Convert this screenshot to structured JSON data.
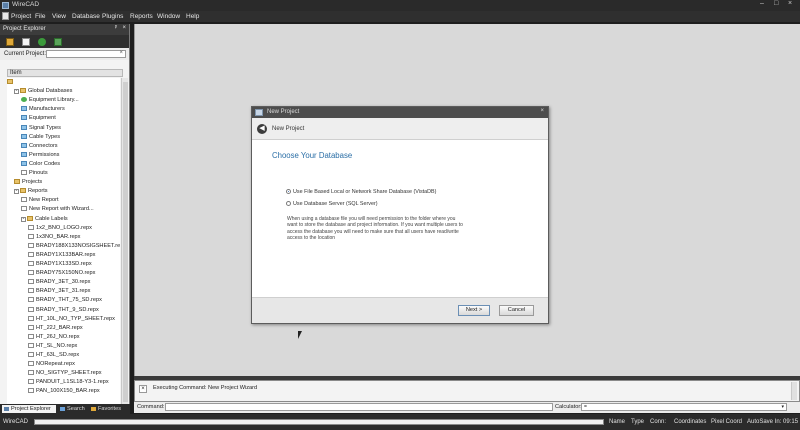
{
  "window": {
    "title": "WireCAD"
  },
  "menu": [
    "Project",
    "File",
    "View",
    "Database",
    "Plugins",
    "Reports",
    "Window",
    "Help"
  ],
  "explorer": {
    "title": "Project Explorer",
    "pin": "ᵖ",
    "close": "×",
    "current_project_label": "Current Project:",
    "current_project_clear": "×",
    "tree_header": "Item",
    "tree": [
      {
        "label": "",
        "indent": 0,
        "icon": "folder",
        "exp": ""
      },
      {
        "label": "Global Databases",
        "indent": 1,
        "icon": "folder",
        "exp": "-"
      },
      {
        "label": "Equipment Library...",
        "indent": 2,
        "icon": "green",
        "exp": ""
      },
      {
        "label": "Manufacturers",
        "indent": 2,
        "icon": "db",
        "exp": ""
      },
      {
        "label": "Equipment",
        "indent": 2,
        "icon": "db",
        "exp": ""
      },
      {
        "label": "Signal Types",
        "indent": 2,
        "icon": "db",
        "exp": ""
      },
      {
        "label": "Cable Types",
        "indent": 2,
        "icon": "db",
        "exp": ""
      },
      {
        "label": "Connectors",
        "indent": 2,
        "icon": "db",
        "exp": ""
      },
      {
        "label": "Permissions",
        "indent": 2,
        "icon": "db",
        "exp": ""
      },
      {
        "label": "Color Codes",
        "indent": 2,
        "icon": "db",
        "exp": ""
      },
      {
        "label": "Pinouts",
        "indent": 2,
        "icon": "doc",
        "exp": ""
      },
      {
        "label": "Projects",
        "indent": 1,
        "icon": "folder",
        "exp": ""
      },
      {
        "label": "Reports",
        "indent": 1,
        "icon": "folder",
        "exp": "-"
      },
      {
        "label": "New Report",
        "indent": 2,
        "icon": "doc",
        "exp": ""
      },
      {
        "label": "New Report with Wizard...",
        "indent": 2,
        "icon": "doc",
        "exp": ""
      },
      {
        "label": "Cable Labels",
        "indent": 2,
        "icon": "folder",
        "exp": "-"
      },
      {
        "label": "1x2_BNO_LOGO.repx",
        "indent": 3,
        "icon": "doc",
        "exp": ""
      },
      {
        "label": "1x3NO_BAR.repx",
        "indent": 3,
        "icon": "doc",
        "exp": ""
      },
      {
        "label": "BRADY188X133NOSIGSHEET.repx",
        "indent": 3,
        "icon": "doc",
        "exp": ""
      },
      {
        "label": "BRADY1X133BAR.repx",
        "indent": 3,
        "icon": "doc",
        "exp": ""
      },
      {
        "label": "BRADY1X133SD.repx",
        "indent": 3,
        "icon": "doc",
        "exp": ""
      },
      {
        "label": "BRADY75X150NO.repx",
        "indent": 3,
        "icon": "doc",
        "exp": ""
      },
      {
        "label": "BRADY_3ET_30.repx",
        "indent": 3,
        "icon": "doc",
        "exp": ""
      },
      {
        "label": "BRADY_3ET_31.repx",
        "indent": 3,
        "icon": "doc",
        "exp": ""
      },
      {
        "label": "BRADY_THT_75_SD.repx",
        "indent": 3,
        "icon": "doc",
        "exp": ""
      },
      {
        "label": "BRADY_THT_9_SD.repx",
        "indent": 3,
        "icon": "doc",
        "exp": ""
      },
      {
        "label": "HT_10L_NO_TYP_SHEET.repx",
        "indent": 3,
        "icon": "doc",
        "exp": ""
      },
      {
        "label": "HT_22J_BAR.repx",
        "indent": 3,
        "icon": "doc",
        "exp": ""
      },
      {
        "label": "HT_26J_NO.repx",
        "indent": 3,
        "icon": "doc",
        "exp": ""
      },
      {
        "label": "HT_SL_NO.repx",
        "indent": 3,
        "icon": "doc",
        "exp": ""
      },
      {
        "label": "HT_63L_SD.repx",
        "indent": 3,
        "icon": "doc",
        "exp": ""
      },
      {
        "label": "NORepeat.repx",
        "indent": 3,
        "icon": "doc",
        "exp": ""
      },
      {
        "label": "NO_SIGTYP_SHEET.repx",
        "indent": 3,
        "icon": "doc",
        "exp": ""
      },
      {
        "label": "PANDUIT_L1SL18-Y3-1.repx",
        "indent": 3,
        "icon": "doc",
        "exp": ""
      },
      {
        "label": "PAN_100X150_BAR.repx",
        "indent": 3,
        "icon": "doc",
        "exp": ""
      }
    ],
    "tabs": {
      "explorer": "Project Explorer",
      "search": "Search",
      "favorites": "Favorites"
    }
  },
  "dialog": {
    "title": "New Project",
    "close": "×",
    "nav_title": "New Project",
    "back_glyph": "◀",
    "heading": "Choose Your Database",
    "options": [
      {
        "label": "Use File Based Local or Network Share Database (VistaDB)",
        "selected": true
      },
      {
        "label": "Use Database Server (SQL Server)",
        "selected": false
      }
    ],
    "info": "When using a database file you will need permission to the folder where you want to store the database and project information. If you want multiple users to access the database you will need to make sure that all users have read/write access to the location",
    "next_label": "Next >",
    "cancel_label": "Cancel"
  },
  "console": {
    "close": "×",
    "text": "Executing Command: New Project Wizard"
  },
  "command_bar": {
    "command_label": "Command:",
    "calculator_label": "Calculator:",
    "calculator_value": "=",
    "dropdown": "▾"
  },
  "status": {
    "app": "WireCAD",
    "name": "Name",
    "type": "Type",
    "conn": "Conn:",
    "coordinates": "Coordinates",
    "pixel_coord": "Pixel Coord",
    "autosave": "AutoSave In: 09:15"
  },
  "window_controls": {
    "minimize": "–",
    "maximize": "□",
    "close": "×"
  },
  "colors": {
    "accent": "#2a6ea6",
    "chrome": "#2b2b2b",
    "workspace": "#d9d9d9"
  }
}
